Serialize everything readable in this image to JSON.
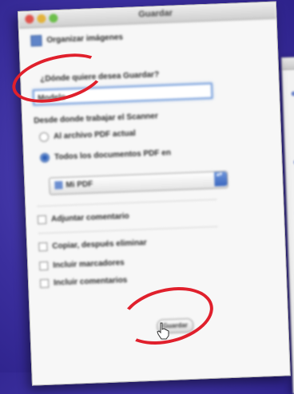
{
  "window": {
    "title": "Guardar"
  },
  "form": {
    "section_header": "Organizar imágenes",
    "name_prompt": "¿Dónde quiere desea Guardar?",
    "name_value": "Modelo",
    "source_label": "Desde donde trabajar el Scanner",
    "radio_option_1": "Al archivo PDF actual",
    "radio_option_2": "Todos los documentos PDF en",
    "popup_value": "Mi PDF",
    "checkbox_1": "Adjuntar comentario",
    "checkbox_2": "Copiar, después eliminar",
    "checkbox_3": "Incluir marcadores",
    "checkbox_4": "Incluir comentarios",
    "action_button": "Guardar"
  },
  "colors": {
    "annotation": "#e0202c",
    "accent": "#5f84c8",
    "background": "#3b2f9e"
  }
}
